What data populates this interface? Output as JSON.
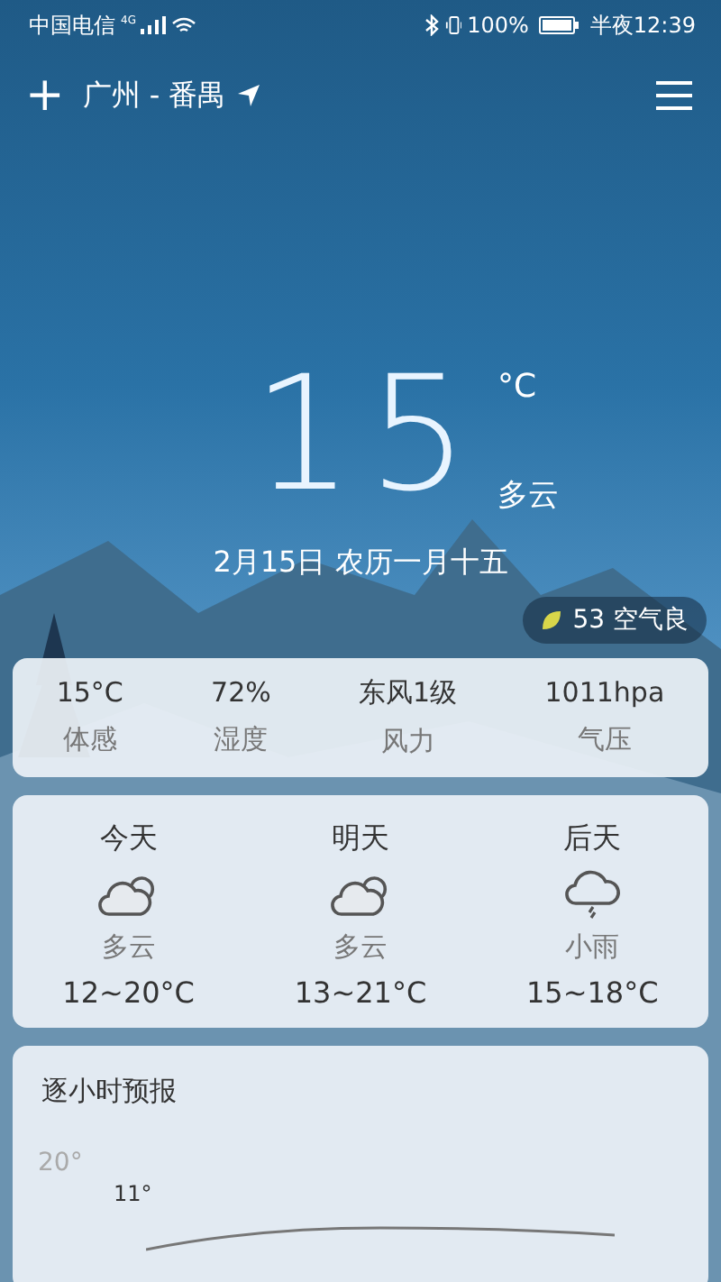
{
  "status_bar": {
    "carrier": "中国电信",
    "network": "4G",
    "battery": "100%",
    "time": "半夜12:39"
  },
  "header": {
    "add": "+",
    "city": "广州 - 番禺"
  },
  "current": {
    "temp": "15",
    "unit": "°C",
    "condition": "多云",
    "date": "2月15日 农历一月十五",
    "aqi": "53 空气良"
  },
  "details": [
    {
      "value": "15°C",
      "label": "体感"
    },
    {
      "value": "72%",
      "label": "湿度"
    },
    {
      "value": "东风1级",
      "label": "风力"
    },
    {
      "value": "1011hpa",
      "label": "气压"
    }
  ],
  "forecast": [
    {
      "day": "今天",
      "kind": "cloudy",
      "condition": "多云",
      "range": "12~20°C"
    },
    {
      "day": "明天",
      "kind": "cloudy",
      "condition": "多云",
      "range": "13~21°C"
    },
    {
      "day": "后天",
      "kind": "rain",
      "condition": "小雨",
      "range": "15~18°C"
    }
  ],
  "hourly": {
    "title": "逐小时预报",
    "axis_label": "20°",
    "point_label": "11°"
  }
}
